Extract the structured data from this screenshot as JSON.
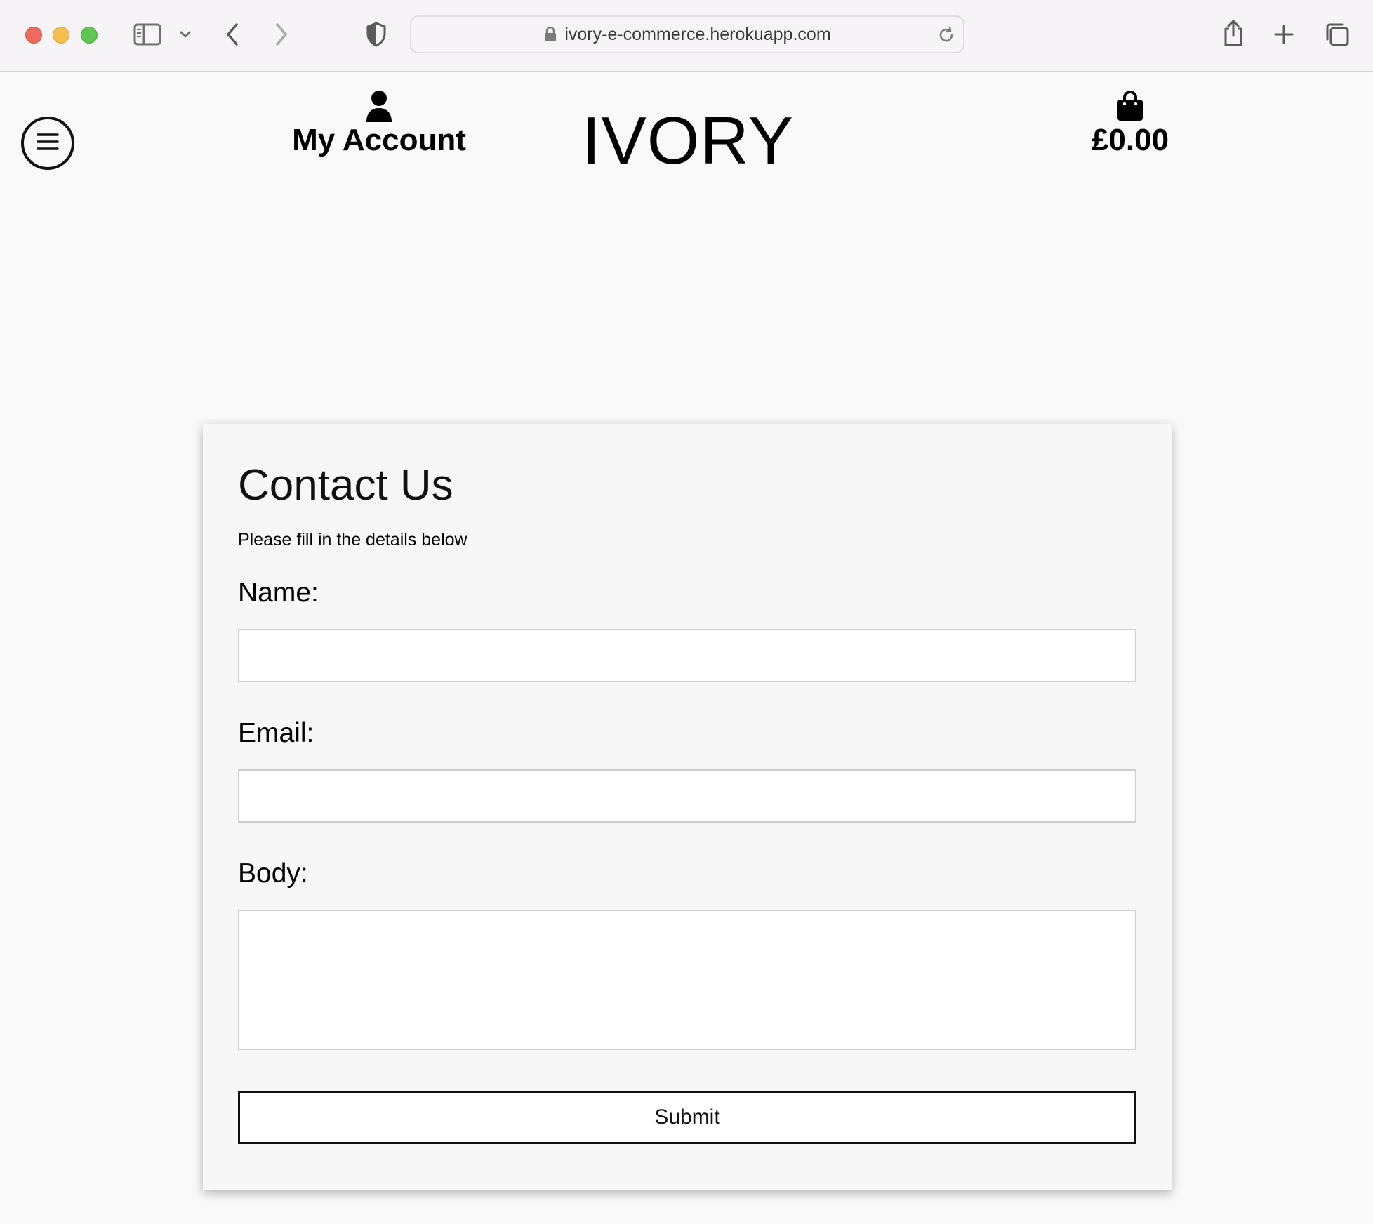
{
  "browser": {
    "url": "ivory-e-commerce.herokuapp.com",
    "icons": [
      "close-window-icon",
      "minimize-window-icon",
      "maximize-window-icon",
      "sidebar-icon",
      "chevron-down-icon",
      "back-icon",
      "forward-icon",
      "shield-icon",
      "lock-icon",
      "reload-icon",
      "share-icon",
      "new-tab-icon",
      "tabs-overview-icon"
    ]
  },
  "header": {
    "menu_icon": "hamburger-icon",
    "account_label": "My Account",
    "account_icon": "user-icon",
    "brand": "IVORY",
    "bag_icon": "shopping-bag-icon",
    "bag_total": "£0.00"
  },
  "contact": {
    "title": "Contact Us",
    "subtitle": "Please fill in the details below",
    "name_label": "Name:",
    "name_value": "",
    "email_label": "Email:",
    "email_value": "",
    "body_label": "Body:",
    "body_value": "",
    "submit_label": "Submit"
  },
  "colors": {
    "page_background": "#f9f9f9",
    "card_background": "#f7f7f7",
    "text": "#000000",
    "input_border": "#cfcfcf"
  }
}
